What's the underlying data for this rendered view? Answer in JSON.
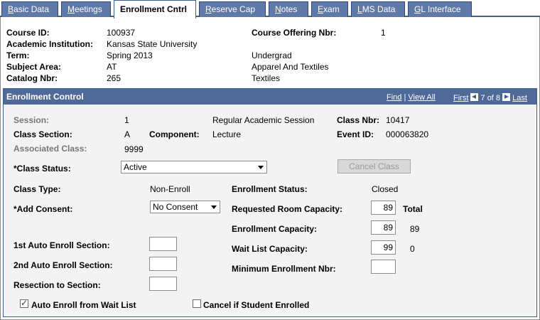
{
  "tabs": [
    {
      "label": "Basic Data",
      "hotkey": "B",
      "rest": "asic Data",
      "active": false
    },
    {
      "label": "Meetings",
      "hotkey": "M",
      "rest": "eetings",
      "active": false
    },
    {
      "label": "Enrollment Cntrl",
      "hotkey": "",
      "rest": "Enrollment Cntrl",
      "active": true
    },
    {
      "label": "Reserve Cap",
      "hotkey": "R",
      "rest": "eserve Cap",
      "active": false
    },
    {
      "label": "Notes",
      "hotkey": "N",
      "rest": "otes",
      "active": false
    },
    {
      "label": "Exam",
      "hotkey": "E",
      "rest": "xam",
      "active": false
    },
    {
      "label": "LMS Data",
      "hotkey": "L",
      "rest": "MS Data",
      "active": false
    },
    {
      "label": "GL Interface",
      "hotkey": "G",
      "rest": "L Interface",
      "active": false
    }
  ],
  "header": {
    "course_id_label": "Course ID:",
    "course_id": "100937",
    "institution_label": "Academic Institution:",
    "institution": "Kansas State University",
    "term_label": "Term:",
    "term": "Spring 2013",
    "career": "Undergrad",
    "subject_label": "Subject Area:",
    "subject": "AT",
    "subject_desc": "Apparel And Textiles",
    "catalog_label": "Catalog Nbr:",
    "catalog": "265",
    "catalog_desc": "Textiles",
    "offering_label": "Course Offering Nbr:",
    "offering": "1"
  },
  "section": {
    "title": "Enrollment Control",
    "find": "Find",
    "view_all": "View All",
    "first": "First",
    "position": "7 of 8",
    "last": "Last",
    "separator": "|"
  },
  "form": {
    "session_label": "Session:",
    "session": "1",
    "session_desc": "Regular Academic Session",
    "class_nbr_label": "Class Nbr:",
    "class_nbr": "10417",
    "class_section_label": "Class Section:",
    "class_section": "A",
    "component_label": "Component:",
    "component": "Lecture",
    "event_id_label": "Event ID:",
    "event_id": "000063820",
    "assoc_label": "Associated Class:",
    "assoc": "9999",
    "status_label": "*Class Status:",
    "status": "Active",
    "cancel_class": "Cancel Class",
    "class_type_label": "Class Type:",
    "class_type": "Non-Enroll",
    "enroll_status_label": "Enrollment Status:",
    "enroll_status": "Closed",
    "consent_label": "*Add Consent:",
    "consent": "No Consent",
    "room_cap_label": "Requested Room Capacity:",
    "room_cap": "89",
    "total_label": "Total",
    "enroll_cap_label": "Enrollment Capacity:",
    "enroll_cap": "89",
    "enroll_total": "89",
    "wait_cap_label": "Wait List Capacity:",
    "wait_cap": "99",
    "wait_total": "0",
    "min_enroll_label": "Minimum Enrollment Nbr:",
    "min_enroll": "",
    "auto1_label": "1st Auto Enroll Section:",
    "auto1": "",
    "auto2_label": "2nd Auto Enroll Section:",
    "auto2": "",
    "resection_label": "Resection to Section:",
    "resection": "",
    "auto_wait_label": "Auto Enroll from Wait List",
    "auto_wait_checked": true,
    "cancel_enrolled_label": "Cancel if Student Enrolled",
    "cancel_enrolled_checked": false
  }
}
